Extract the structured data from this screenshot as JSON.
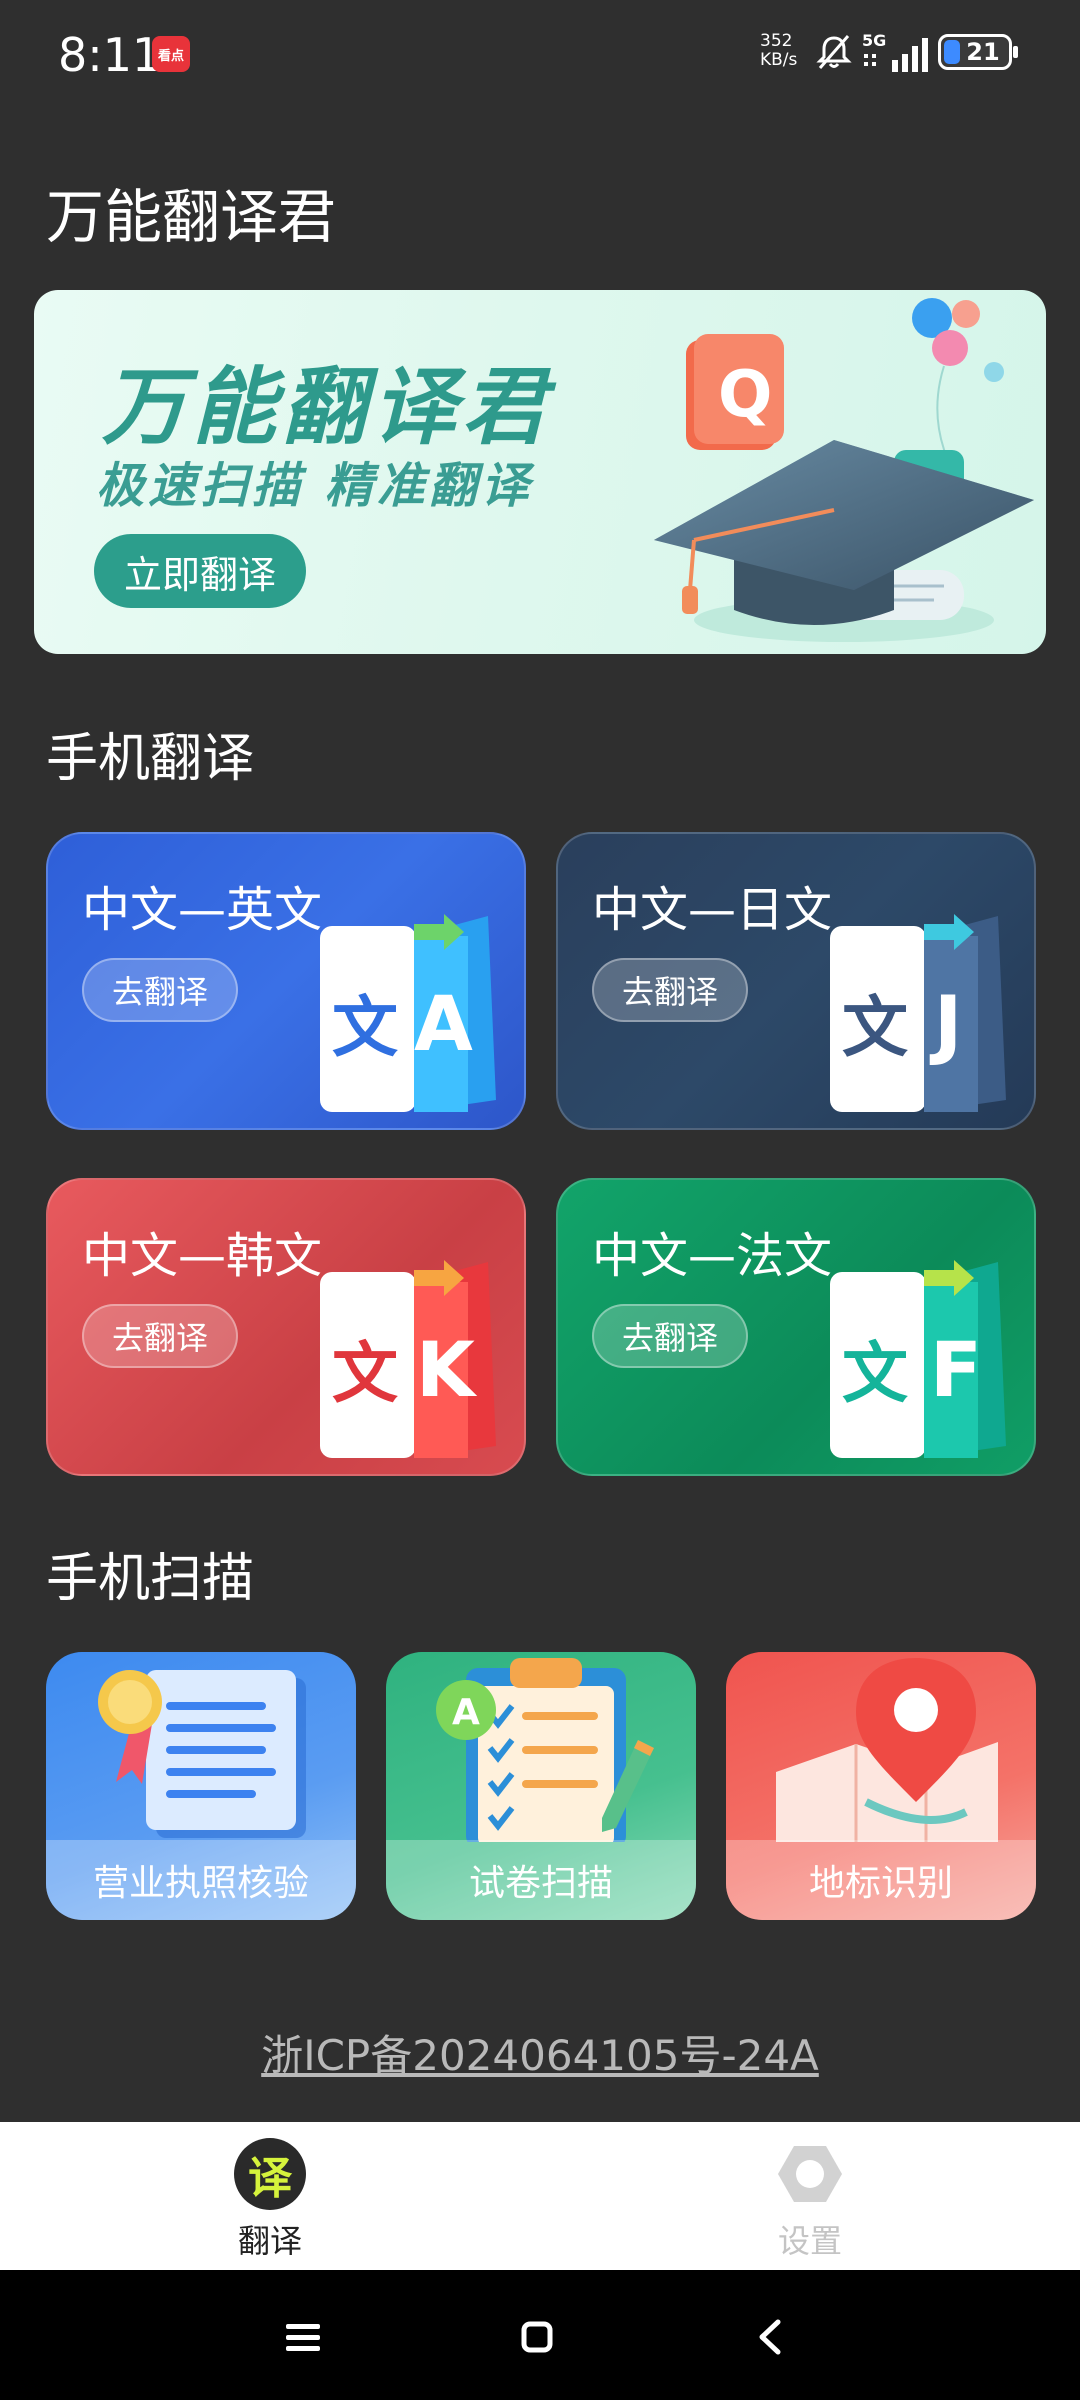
{
  "status_bar": {
    "time": "8:11",
    "app_icon_text": "看点",
    "net_speed_value": "352",
    "net_speed_unit": "KB/s",
    "network": "5G",
    "battery": "21"
  },
  "app": {
    "title": "万能翻译君"
  },
  "banner": {
    "title": "万能翻译君",
    "subtitle": "极速扫描  精准翻译",
    "button": "立即翻译"
  },
  "translate_section": {
    "title": "手机翻译",
    "cards": [
      {
        "label": "中文—英文",
        "button": "去翻译",
        "letter": "A",
        "char": "文",
        "accent": "#3b82f6"
      },
      {
        "label": "中文—日文",
        "button": "去翻译",
        "letter": "J",
        "char": "文",
        "accent": "#3f5f8a"
      },
      {
        "label": "中文—韩文",
        "button": "去翻译",
        "letter": "K",
        "char": "文",
        "accent": "#ef4444"
      },
      {
        "label": "中文—法文",
        "button": "去翻译",
        "letter": "F",
        "char": "文",
        "accent": "#10b59a"
      }
    ]
  },
  "scan_section": {
    "title": "手机扫描",
    "cards": [
      {
        "label": "营业执照核验",
        "icon": "license-icon"
      },
      {
        "label": "试卷扫描",
        "icon": "clipboard-icon"
      },
      {
        "label": "地标识别",
        "icon": "map-pin-icon"
      }
    ]
  },
  "footer": {
    "icp": "浙ICP备2024064105号-24A"
  },
  "bottom_nav": {
    "items": [
      {
        "label": "翻译",
        "icon_char": "译",
        "active": true
      },
      {
        "label": "设置",
        "active": false
      }
    ]
  },
  "colors": {
    "background": "#2f2f2f",
    "banner_accent": "#2c9e8c",
    "nav_active_icon": "#d6f33c"
  }
}
